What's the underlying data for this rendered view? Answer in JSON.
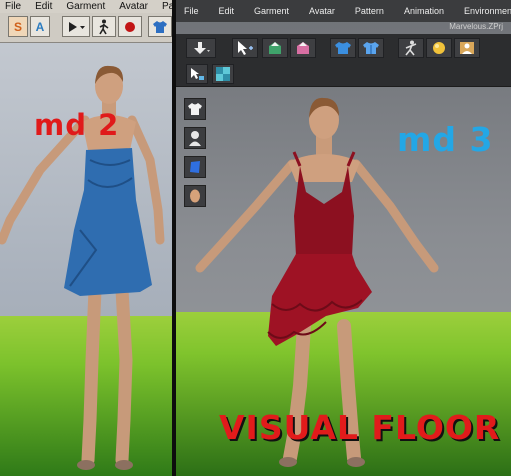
{
  "left_app": {
    "menu": [
      "File",
      "Edit",
      "Garment",
      "Avatar",
      "Pat"
    ],
    "toolbar": {
      "s_button": "S",
      "a_button": "A"
    },
    "overlay_label": "md 2",
    "dress_color": "#2f6db0"
  },
  "right_app": {
    "menu": [
      "File",
      "Edit",
      "Garment",
      "Avatar",
      "Pattern",
      "Animation",
      "Environment"
    ],
    "project_title": "Marvelous.ZPrj",
    "overlay_label": "md 3",
    "floor_label": "VISUAL  FLOOR",
    "dress_color": "#8c1020"
  },
  "colors": {
    "left_label": "#e01a1a",
    "right_label": "#23a7e6",
    "floor_label": "#e11b1b",
    "floor_green": "#7cc22c"
  }
}
